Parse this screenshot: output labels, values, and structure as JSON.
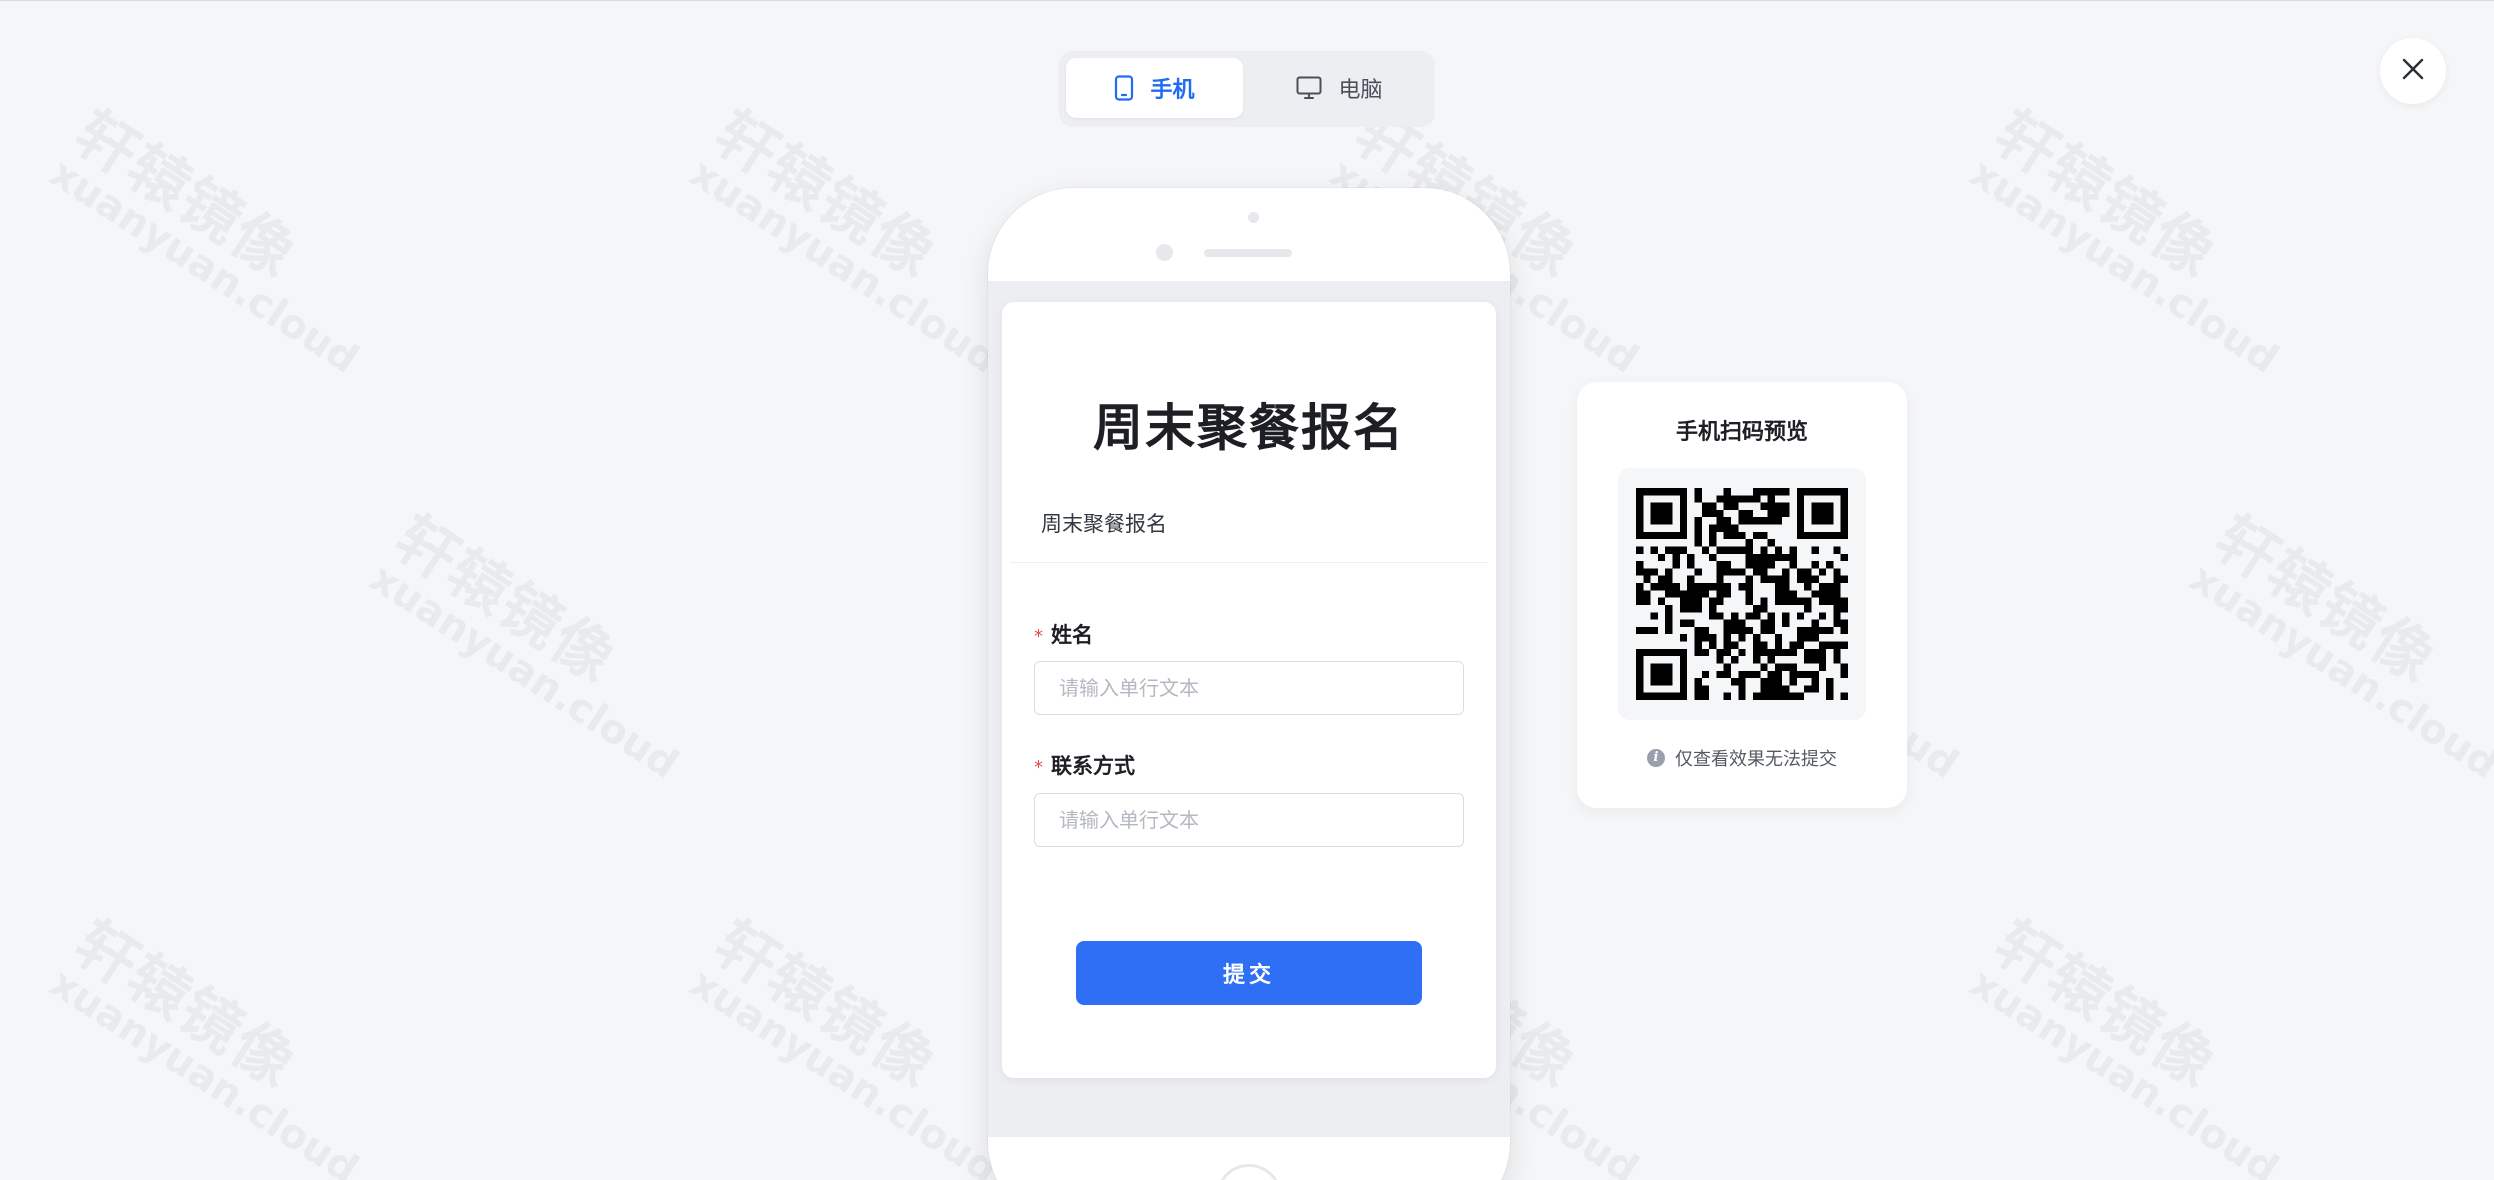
{
  "watermark": {
    "text_cn": "轩辕镜像",
    "text_en": "xuanyuan.cloud"
  },
  "device_toggle": {
    "options": [
      {
        "label": "手机",
        "icon": "mobile-phone-icon",
        "active": true
      },
      {
        "label": "电脑",
        "icon": "desktop-monitor-icon",
        "active": false
      }
    ]
  },
  "close_button": {
    "icon": "close-icon"
  },
  "form": {
    "title": "周末聚餐报名",
    "description": "周末聚餐报名",
    "fields": [
      {
        "label": "姓名",
        "required": true,
        "placeholder": "请输入单行文本",
        "value": ""
      },
      {
        "label": "联系方式",
        "required": true,
        "placeholder": "请输入单行文本",
        "value": ""
      }
    ],
    "required_mark": "*",
    "submit_label": "提交"
  },
  "qr_preview": {
    "title": "手机扫码预览",
    "note": "仅查看效果无法提交",
    "info_icon_glyph": "i"
  },
  "colors": {
    "accent": "#2f6ff5",
    "active_tab_text": "#1f6cf1",
    "required": "#e5484d",
    "background": "#f5f6f8"
  }
}
